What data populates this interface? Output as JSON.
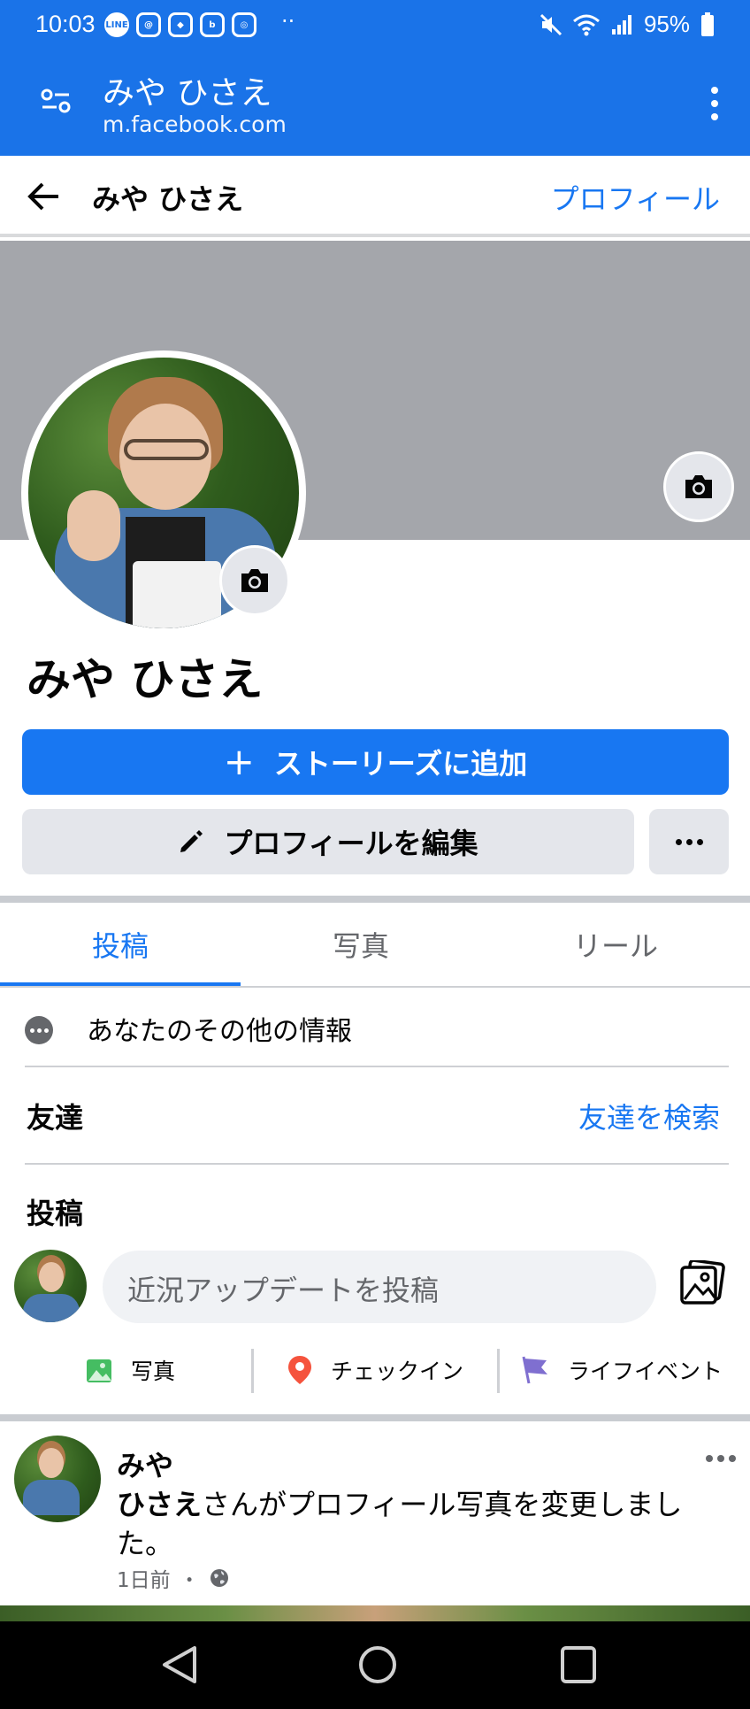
{
  "status_bar": {
    "time": "10:03",
    "notifications": [
      "LINE",
      "threads",
      "app",
      "bluesky",
      "instagram"
    ],
    "more": "··",
    "battery": "95%",
    "icons": [
      "mute-icon",
      "wifi-icon",
      "signal-icon",
      "battery-icon"
    ]
  },
  "browser": {
    "title": "みや ひさえ",
    "url": "m.facebook.com"
  },
  "header": {
    "name": "みや ひさえ",
    "profile_link": "プロフィール"
  },
  "profile": {
    "name": "みや ひさえ",
    "add_story": "ストーリーズに追加",
    "edit_profile": "プロフィールを編集"
  },
  "tabs": [
    {
      "label": "投稿",
      "active": true
    },
    {
      "label": "写真",
      "active": false
    },
    {
      "label": "リール",
      "active": false
    }
  ],
  "info": {
    "label": "あなたのその他の情報"
  },
  "friends": {
    "heading": "友達",
    "search_link": "友達を検索"
  },
  "posts": {
    "heading": "投稿",
    "composer_placeholder": "近況アップデートを投稿",
    "actions": [
      {
        "label": "写真",
        "icon": "photo-icon",
        "color": "#45bd62"
      },
      {
        "label": "チェックイン",
        "icon": "location-pin-icon",
        "color": "#f5533d"
      },
      {
        "label": "ライフイベント",
        "icon": "flag-icon",
        "color": "#7f6fd0"
      }
    ]
  },
  "feed_post": {
    "author": "みや\nひさえ",
    "text": "さんがプロフィール写真を変更しました。",
    "time": "1日前",
    "separator": "・"
  },
  "colors": {
    "chrome": "#1a73e8",
    "accent": "#1877f2",
    "button_gray": "#e4e6eb",
    "cover": "#a4a6ab"
  }
}
